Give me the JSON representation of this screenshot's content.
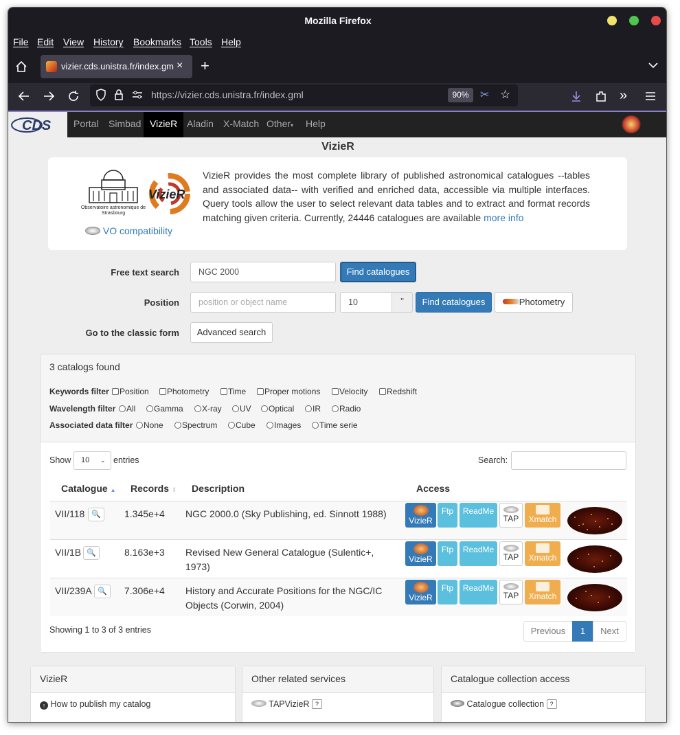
{
  "browser": {
    "title": "Mozilla Firefox",
    "menu": [
      "File",
      "Edit",
      "View",
      "History",
      "Bookmarks",
      "Tools",
      "Help"
    ],
    "tab_title": "vizier.cds.unistra.fr/index.gml",
    "url": "https://vizier.cds.unistra.fr/index.gml",
    "zoom": "90%"
  },
  "cds_nav": {
    "logo": "CDS",
    "items": [
      "Portal",
      "Simbad",
      "VizieR",
      "Aladin",
      "X-Match",
      "Other",
      "Help"
    ],
    "active": "VizieR",
    "right_logo": "VizieR"
  },
  "page_title": "VizieR",
  "intro": {
    "obs_name": "Observatoire astronomique de Strasbourg",
    "vizier_logo": "VizieR",
    "vo_link": "VO compatibility",
    "text": "VizieR provides the most complete library of published astronomical catalogues --tables and associated data-- with verified and enriched data, accessible via multiple interfaces. Query tools allow the user to select relevant data tables and to extract and format records matching given criteria. Currently, 24446 catalogues are available",
    "more_link": "more info"
  },
  "search": {
    "free_label": "Free text search",
    "free_value": "NGC 2000",
    "find_label": "Find catalogues",
    "position_label": "Position",
    "position_placeholder": "position or object name",
    "radius_value": "10",
    "radius_unit": "\"",
    "photometry_label": "Photometry",
    "classic_label": "Go to the classic form",
    "advanced_label": "Advanced search"
  },
  "results": {
    "count_text": "3 catalogs found",
    "keyword_filter": {
      "label": "Keywords filter",
      "options": [
        "Position",
        "Photometry",
        "Time",
        "Proper motions",
        "Velocity",
        "Redshift"
      ]
    },
    "wavelength_filter": {
      "label": "Wavelength filter",
      "options": [
        "All",
        "Gamma",
        "X-ray",
        "UV",
        "Optical",
        "IR",
        "Radio"
      ]
    },
    "assoc_filter": {
      "label": "Associated data filter",
      "options": [
        "None",
        "Spectrum",
        "Cube",
        "Images",
        "Time serie"
      ]
    },
    "show_label": "Show",
    "entries_value": "10",
    "entries_label": "entries",
    "search_label": "Search:",
    "columns": [
      "Catalogue",
      "Records",
      "Description",
      "Access"
    ],
    "rows": [
      {
        "catalogue": "VII/118",
        "records": "1.345e+4",
        "description": "NGC 2000.0 (Sky Publishing, ed. Sinnott 1988)"
      },
      {
        "catalogue": "VII/1B",
        "records": "8.163e+3",
        "description": "Revised New General Catalogue (Sulentic+, 1973)"
      },
      {
        "catalogue": "VII/239A",
        "records": "7.306e+4",
        "description": "History and Accurate Positions for the NGC/IC Objects (Corwin, 2004)"
      }
    ],
    "access_buttons": {
      "vizier": "VizieR",
      "ftp": "Ftp",
      "readme": "ReadMe",
      "tap": "TAP",
      "xmatch": "Xmatch"
    },
    "showing": "Showing 1 to 3 of 3 entries",
    "pagination": {
      "previous": "Previous",
      "current": "1",
      "next": "Next"
    }
  },
  "footer_panels": [
    {
      "title": "VizieR",
      "item": "How to publish my catalog"
    },
    {
      "title": "Other related services",
      "item": "TAPVizieR"
    },
    {
      "title": "Catalogue collection access",
      "item": "Catalogue collection"
    }
  ],
  "colors": {
    "primary": "#337ab7",
    "info": "#5bc0de",
    "warning": "#f0ad4e",
    "dark_nav": "#222222"
  }
}
